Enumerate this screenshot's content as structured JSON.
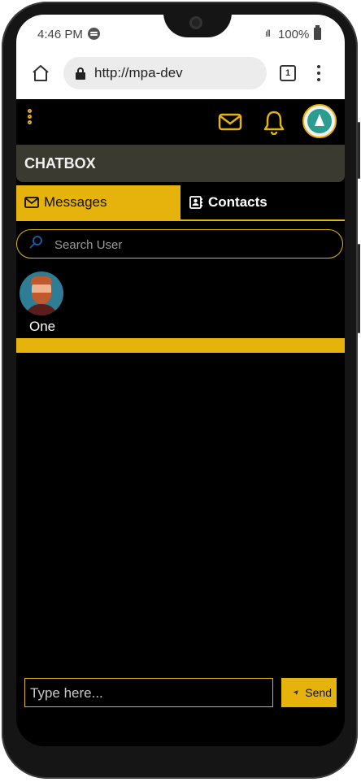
{
  "statusbar": {
    "time": "4:46 PM",
    "signal": "ıll",
    "battery": "100%"
  },
  "browser": {
    "url": "http://mpa-dev",
    "tab_count": "1"
  },
  "app": {
    "section_title": "CHATBOX",
    "tabs": [
      {
        "label": "Messages"
      },
      {
        "label": "Contacts"
      }
    ],
    "search": {
      "placeholder": "Search User"
    },
    "users": [
      {
        "name": "One"
      }
    ],
    "composer": {
      "placeholder": "Type here...",
      "send_label": "Send"
    }
  },
  "colors": {
    "accent": "#e5b30b",
    "background": "#000000",
    "title_bar": "#3a3a30"
  }
}
